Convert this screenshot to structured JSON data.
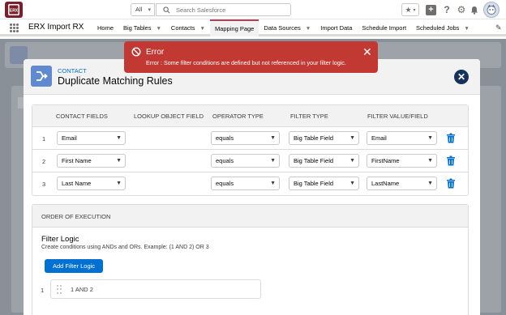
{
  "app": {
    "name": "ERX Import RX",
    "logo_text": "ERX"
  },
  "search": {
    "scope": "All",
    "placeholder": "Search Salesforce"
  },
  "nav": {
    "items": [
      {
        "label": "Home",
        "dropdown": false,
        "active": false
      },
      {
        "label": "Big Tables",
        "dropdown": true,
        "active": false
      },
      {
        "label": "Contacts",
        "dropdown": true,
        "active": false
      },
      {
        "label": "Mapping Page",
        "dropdown": false,
        "active": true
      },
      {
        "label": "Data Sources",
        "dropdown": true,
        "active": false
      },
      {
        "label": "Import Data",
        "dropdown": false,
        "active": false
      },
      {
        "label": "Schedule Import",
        "dropdown": false,
        "active": false
      },
      {
        "label": "Scheduled Jobs",
        "dropdown": true,
        "active": false
      }
    ]
  },
  "toast": {
    "title": "Error",
    "message": "Error : Some filter conditions are defined but not referenced in your filter logic.",
    "color": "#c23934"
  },
  "modal": {
    "object_label": "CONTACT",
    "title": "Duplicate Matching Rules",
    "columns": [
      "CONTACT FIELDS",
      "LOOKUP OBJECT FIELD",
      "OPERATOR TYPE",
      "FILTER TYPE",
      "FILTER VALUE/FIELD"
    ],
    "rows": [
      {
        "num": "1",
        "field": "Email",
        "operator": "equals",
        "filter_type": "Big Table Field",
        "value": "Email"
      },
      {
        "num": "2",
        "field": "First Name",
        "operator": "equals",
        "filter_type": "Big Table Field",
        "value": "FirstName"
      },
      {
        "num": "3",
        "field": "Last Name",
        "operator": "equals",
        "filter_type": "Big Table Field",
        "value": "LastName"
      }
    ],
    "order_section": {
      "heading": "ORDER OF EXECUTION",
      "filter_logic_title": "Filter Logic",
      "filter_logic_help": "Create conditions using ANDs and ORs. Example: (1 AND 2) OR 3",
      "add_button": "Add Filter Logic",
      "logic_rows": [
        {
          "num": "1",
          "text": "1 AND 2"
        }
      ]
    }
  },
  "colors": {
    "brand": "#0070d2",
    "error": "#c23934",
    "nav_accent": "#a7465b",
    "close_button": "#16325c"
  }
}
